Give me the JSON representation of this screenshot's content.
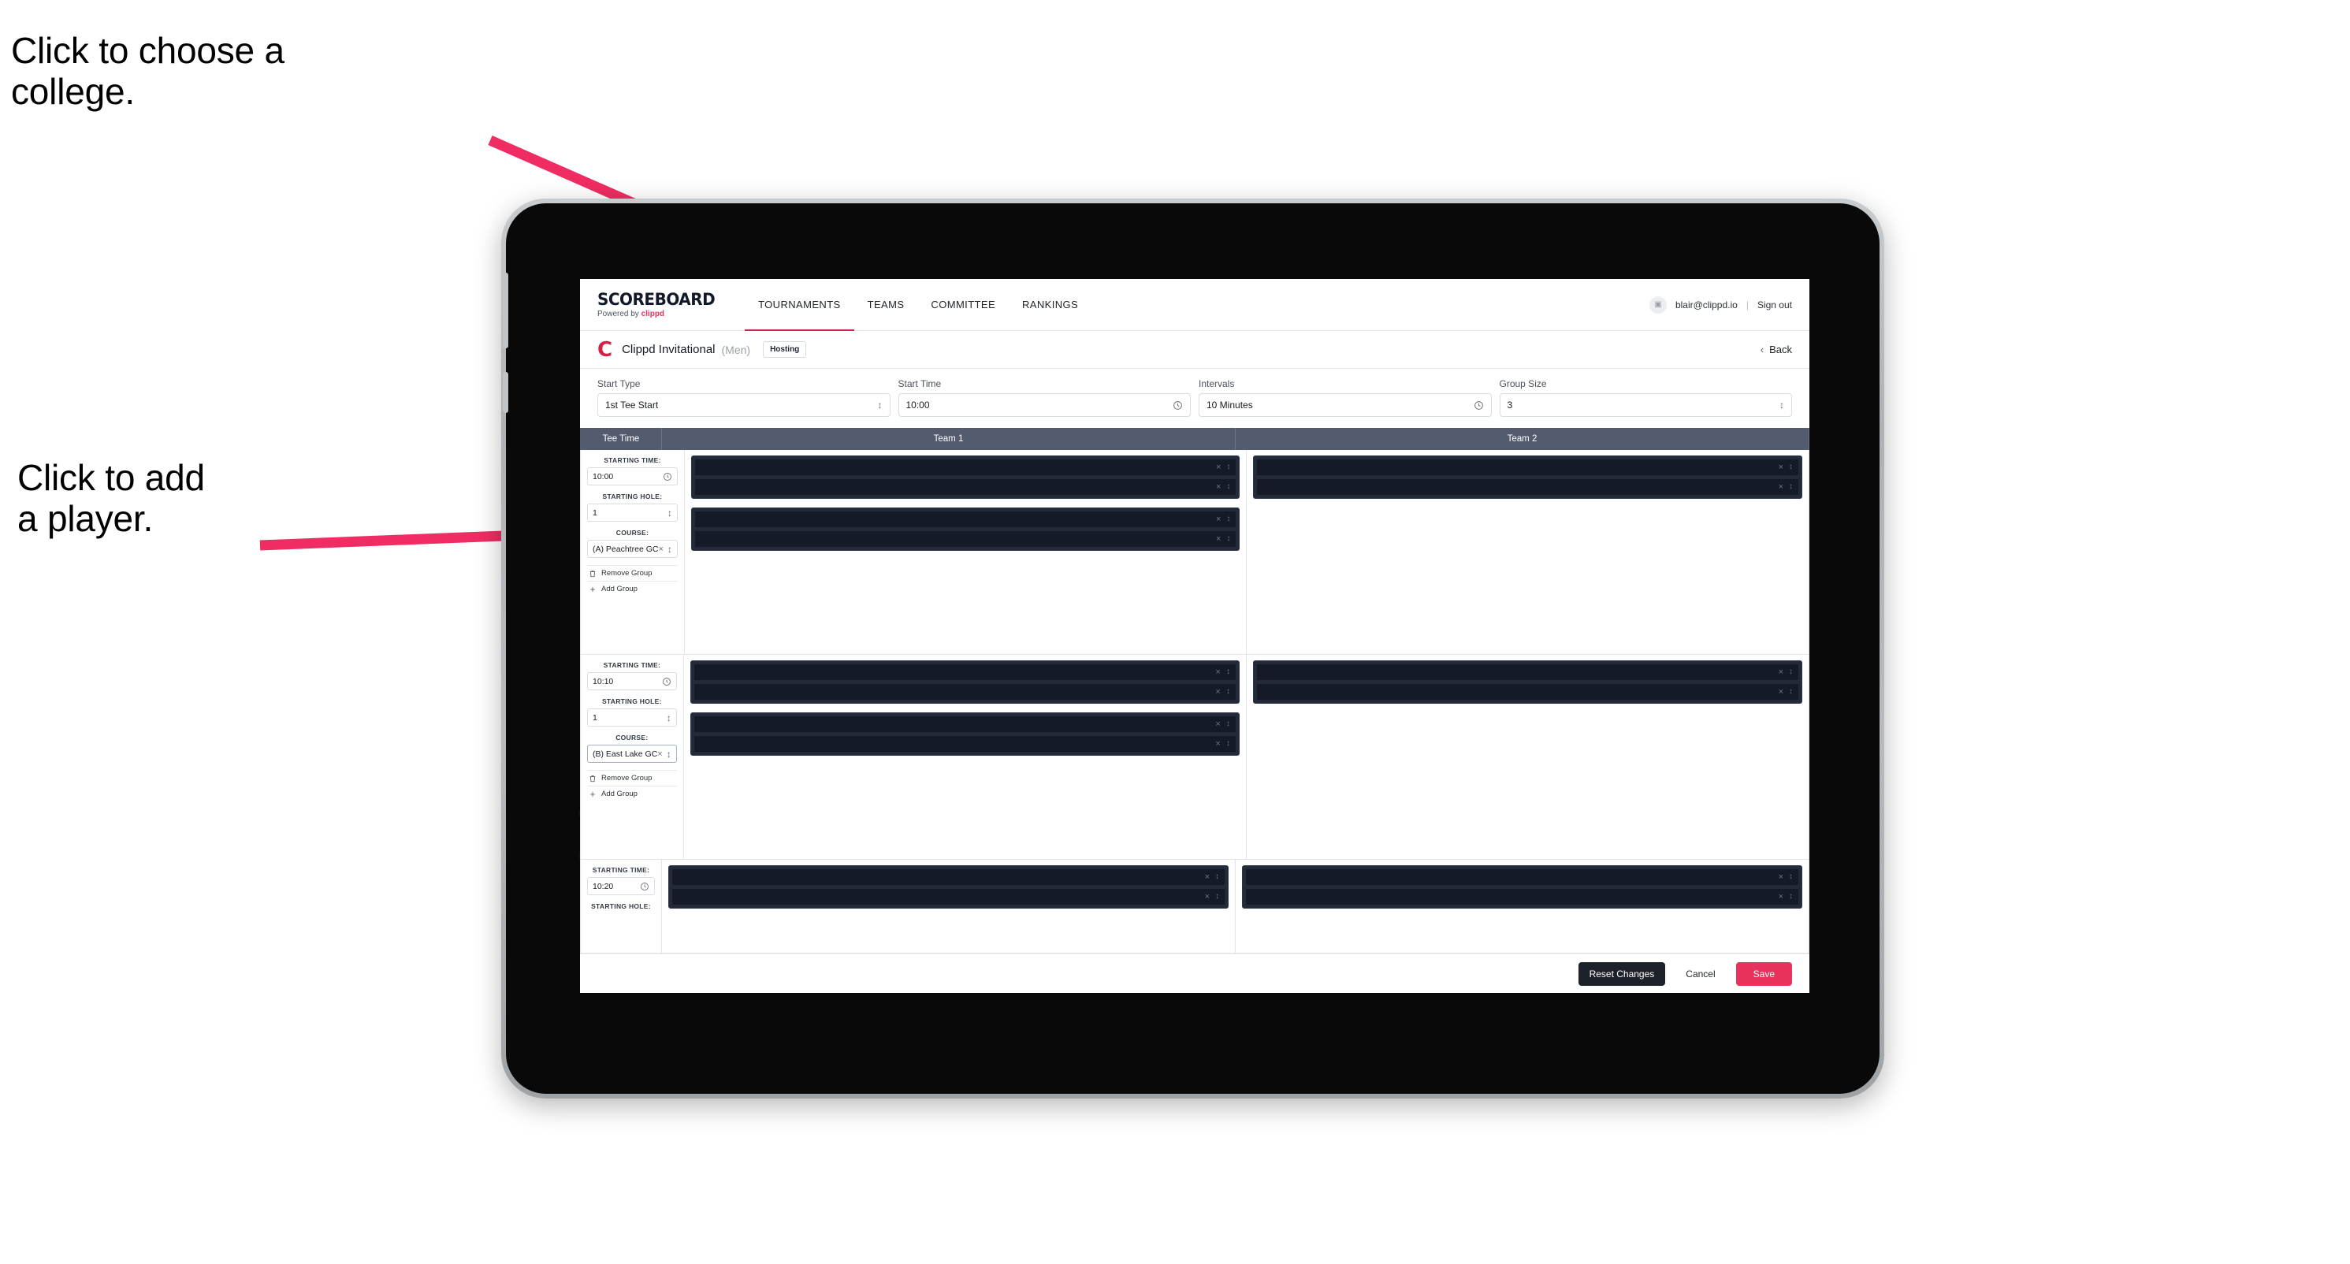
{
  "annotations": {
    "choose_college": "Click to choose a\ncollege.",
    "add_player": "Click to add\na player."
  },
  "colors": {
    "accent_pink": "#e8315c",
    "brand_red": "#d61f45",
    "header_slate": "#535b6e",
    "slot_dark": "#141a27",
    "slot_block": "#232b3a",
    "annotation_arrow": "#ef2d62"
  },
  "topnav": {
    "brand_title": "SCOREBOARD",
    "brand_subtitle_prefix": "Powered by",
    "brand_subtitle_word": "clippd",
    "tabs": [
      {
        "label": "TOURNAMENTS",
        "active": true
      },
      {
        "label": "TEAMS",
        "active": false
      },
      {
        "label": "COMMITTEE",
        "active": false
      },
      {
        "label": "RANKINGS",
        "active": false
      }
    ],
    "avatar_icon": "user-avatar-icon",
    "user_email": "blair@clippd.io",
    "separator": "|",
    "signout_label": "Sign out"
  },
  "titlebar": {
    "logo_letter": "C",
    "tournament_name": "Clippd Invitational",
    "gender": "(Men)",
    "hosting_badge": "Hosting",
    "back_chevron": "‹",
    "back_label": "Back"
  },
  "settings": {
    "fields": [
      {
        "label": "Start Type",
        "value": "1st Tee Start",
        "control": "stepper"
      },
      {
        "label": "Start Time",
        "value": "10:00",
        "control": "clock"
      },
      {
        "label": "Intervals",
        "value": "10 Minutes",
        "control": "clock"
      },
      {
        "label": "Group Size",
        "value": "3",
        "control": "stepper"
      }
    ]
  },
  "grid": {
    "columns": [
      "Tee Time",
      "Team 1",
      "Team 2"
    ],
    "labels": {
      "starting_time": "STARTING TIME:",
      "starting_hole": "STARTING HOLE:",
      "course": "COURSE:",
      "remove_group": "Remove Group",
      "add_group": "Add Group",
      "clear_glyph": "×",
      "stepper_glyph": "⌃⌄",
      "slot_placeholder": ""
    },
    "rows": [
      {
        "starting_time": "10:00",
        "starting_hole": "1",
        "course": "(A) Peachtree GC",
        "course_focused": false,
        "team1_blocks": [
          2,
          2
        ],
        "team2_blocks": [
          2
        ]
      },
      {
        "starting_time": "10:10",
        "starting_hole": "1",
        "course": "(B) East Lake GC",
        "course_focused": true,
        "team1_blocks": [
          2,
          2
        ],
        "team2_blocks": [
          2
        ]
      },
      {
        "starting_time": "10:20",
        "starting_hole": "",
        "course": "",
        "course_focused": false,
        "team1_blocks": [
          2
        ],
        "team2_blocks": [
          2
        ]
      }
    ]
  },
  "footer": {
    "reset_label": "Reset Changes",
    "cancel_label": "Cancel",
    "save_label": "Save"
  }
}
